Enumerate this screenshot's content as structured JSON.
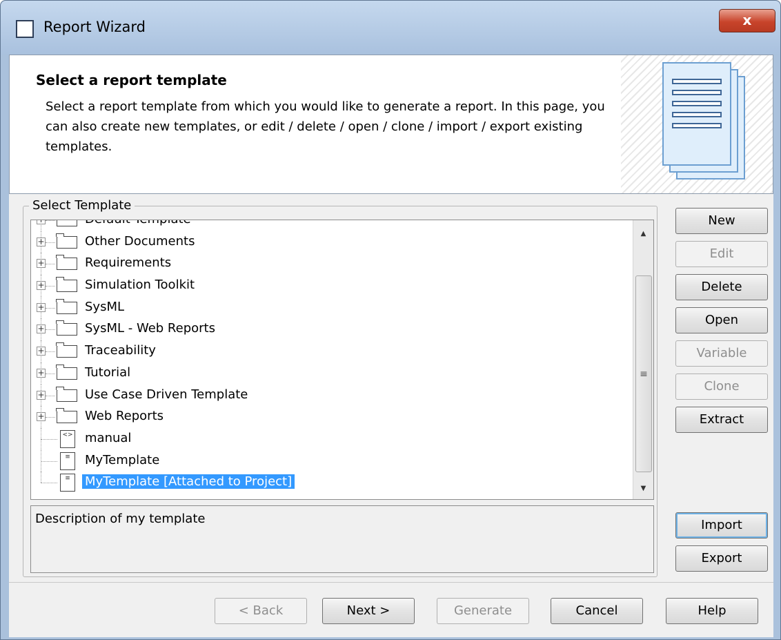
{
  "window": {
    "title": "Report Wizard",
    "close_label": "x"
  },
  "header": {
    "title": "Select a report template",
    "description": "Select a report template from which you would like to generate a report. In this page, you can also create new templates, or edit / delete / open / clone / import / export existing templates."
  },
  "template_group": {
    "label": "Select Template",
    "items": [
      {
        "label": "Default Template",
        "type": "folder"
      },
      {
        "label": "Other Documents",
        "type": "folder"
      },
      {
        "label": "Requirements",
        "type": "folder"
      },
      {
        "label": "Simulation Toolkit",
        "type": "folder"
      },
      {
        "label": "SysML",
        "type": "folder"
      },
      {
        "label": "SysML - Web Reports",
        "type": "folder"
      },
      {
        "label": "Traceability",
        "type": "folder"
      },
      {
        "label": "Tutorial",
        "type": "folder"
      },
      {
        "label": "Use Case Driven Template",
        "type": "folder"
      },
      {
        "label": "Web Reports",
        "type": "folder"
      },
      {
        "label": "manual",
        "type": "file"
      },
      {
        "label": "MyTemplate",
        "type": "file"
      },
      {
        "label": "MyTemplate [Attached to Project]",
        "type": "file",
        "selected": true
      }
    ],
    "description": "Description of my template"
  },
  "side_buttons": {
    "new": "New",
    "edit": "Edit",
    "delete": "Delete",
    "open": "Open",
    "variable": "Variable",
    "clone": "Clone",
    "extract": "Extract",
    "import": "Import",
    "export": "Export"
  },
  "footer": {
    "back": "< Back",
    "next": "Next >",
    "generate": "Generate",
    "cancel": "Cancel",
    "help": "Help"
  }
}
